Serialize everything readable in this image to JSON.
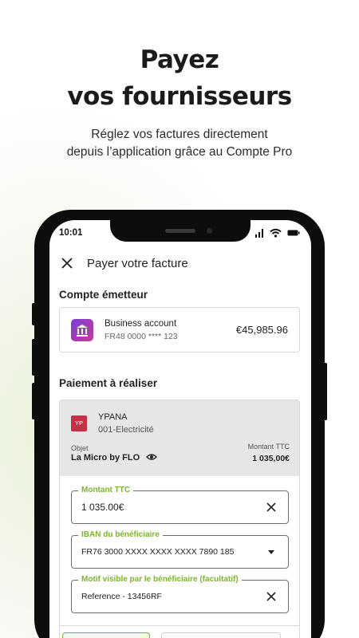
{
  "promo": {
    "headline_line1": "Payez",
    "headline_line2": "vos fournisseurs",
    "sub_line1": "Réglez vos factures directement",
    "sub_line2": "depuis l’application grâce au Compte Pro"
  },
  "status_bar": {
    "time": "10:01"
  },
  "app": {
    "title": "Payer votre facture",
    "issuer_section": "Compte émetteur",
    "account": {
      "name": "Business account",
      "iban": "FR48 0000 **** 123",
      "balance": "€45,985.96"
    },
    "payment_section": "Paiement à réaliser",
    "supplier": {
      "initials": "YP",
      "name": "YPANA",
      "reference": "001-Electricité",
      "object_label": "Objet",
      "object_value": "La Micro by FLO",
      "amount_label": "Montant TTC",
      "amount_value": "1 035,00€"
    },
    "fields": {
      "amount": {
        "label": "Montant TTC",
        "value": "1 035.00€"
      },
      "iban": {
        "label": "IBAN du bénéficiaire",
        "value": "FR76 3000 XXXX XXXX XXXX 7890 185"
      },
      "reason": {
        "label": "Motif visible par le bénéficiaire (facultatif)",
        "value": "Reference - 13456RF"
      }
    }
  },
  "colors": {
    "accent": "#7bb52a",
    "supplier_badge": "#c62f45",
    "bank_icon_start": "#7c3fd8",
    "bank_icon_end": "#c43b9a"
  },
  "icons": [
    "close-icon",
    "bank-icon",
    "eye-icon",
    "clear-icon",
    "dropdown-arrow-icon",
    "signal-icon",
    "wifi-icon",
    "battery-icon"
  ]
}
